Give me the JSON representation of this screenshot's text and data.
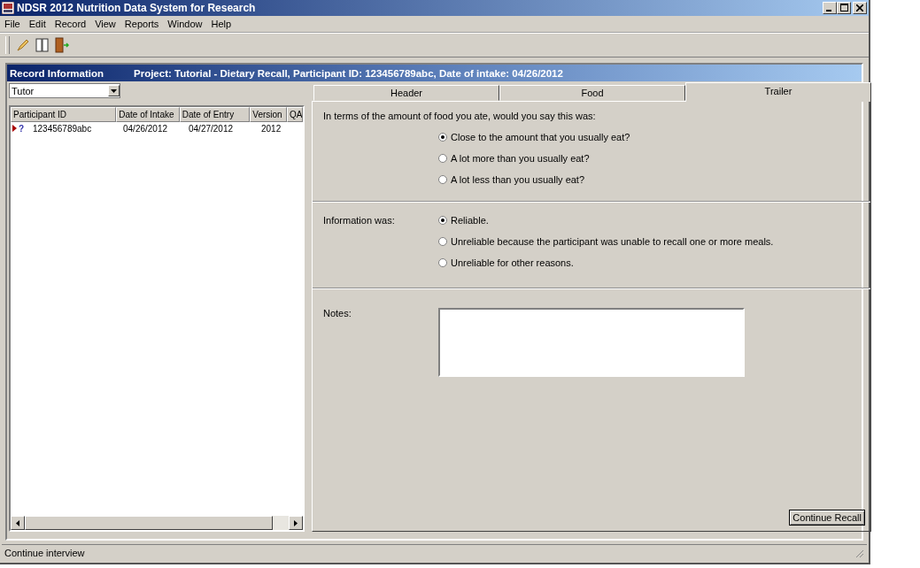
{
  "window": {
    "title": "NDSR 2012 Nutrition Data System for Research"
  },
  "menu": [
    "File",
    "Edit",
    "Record",
    "View",
    "Reports",
    "Window",
    "Help"
  ],
  "record_panel": {
    "title": "Record Information",
    "project": "Project: Tutorial - Dietary Recall, Participant ID: 123456789abc, Date of intake: 04/26/2012"
  },
  "filter": {
    "value": "Tutor"
  },
  "table": {
    "columns": [
      "Participant ID",
      "Date of Intake",
      "Date of Entry",
      "Version",
      "QA"
    ],
    "rows": [
      {
        "marker": "?",
        "cells": [
          "123456789abc",
          "04/26/2012",
          "04/27/2012",
          "2012",
          ""
        ],
        "selected": false
      }
    ]
  },
  "tabs": [
    {
      "label": "Header",
      "selected": false
    },
    {
      "label": "Food",
      "selected": false
    },
    {
      "label": "Trailer",
      "selected": true
    }
  ],
  "amount": {
    "question": "In terms of the amount of food you ate, would you say this was:",
    "options": [
      {
        "label": "Close to the amount that you usually eat?",
        "selected": true
      },
      {
        "label": "A lot more than you usually eat?",
        "selected": false
      },
      {
        "label": "A lot less than you usually eat?",
        "selected": false
      }
    ]
  },
  "information": {
    "label": "Information was:",
    "options": [
      {
        "label": "Reliable.",
        "selected": true
      },
      {
        "label": "Unreliable because the participant was unable to recall one or more meals.",
        "selected": false
      },
      {
        "label": "Unreliable for other reasons.",
        "selected": false
      }
    ]
  },
  "notes": {
    "label": "Notes:"
  },
  "continue_button": "Continue Recall",
  "status_bar": "Continue interview"
}
